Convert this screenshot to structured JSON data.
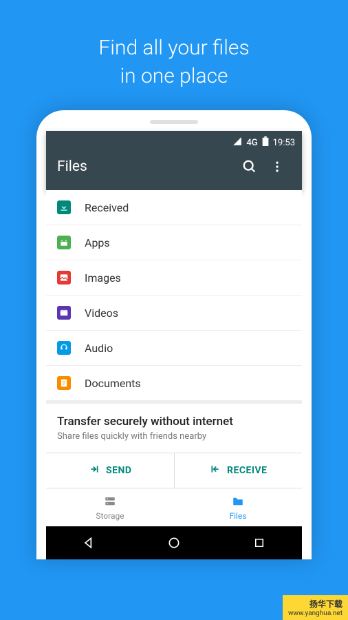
{
  "promo": {
    "line1": "Find all your files",
    "line2": "in one place"
  },
  "status": {
    "network": "4G",
    "time": "19:53"
  },
  "appbar": {
    "title": "Files"
  },
  "categories": [
    {
      "label": "Received",
      "icon_bg": "#00897B"
    },
    {
      "label": "Apps",
      "icon_bg": "#4CAF50"
    },
    {
      "label": "Images",
      "icon_bg": "#E53935"
    },
    {
      "label": "Videos",
      "icon_bg": "#5E35B1"
    },
    {
      "label": "Audio",
      "icon_bg": "#039BE5"
    },
    {
      "label": "Documents",
      "icon_bg": "#FB8C00"
    }
  ],
  "transfer": {
    "title": "Transfer securely without internet",
    "subtitle": "Share files quickly with friends nearby",
    "send_label": "SEND",
    "receive_label": "RECEIVE"
  },
  "tabs": {
    "storage": "Storage",
    "files": "Files"
  },
  "watermark": {
    "line1": "扬华下载",
    "line2": "www.yanghua.net"
  }
}
